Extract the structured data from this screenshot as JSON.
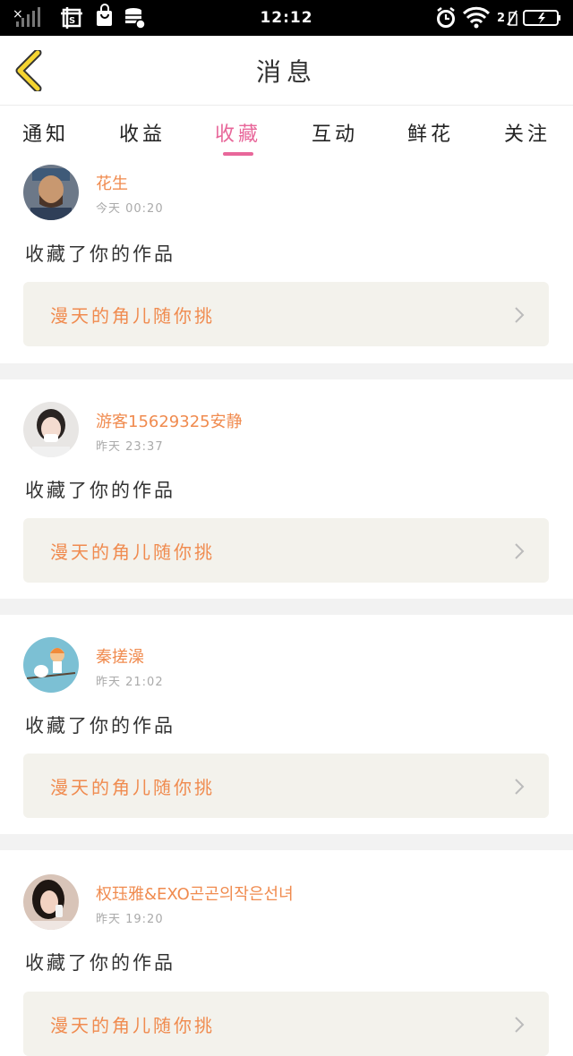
{
  "status_bar": {
    "time": "12:12",
    "battery_label": "2"
  },
  "header": {
    "title": "消息"
  },
  "tabs": [
    {
      "label": "通知",
      "active": false
    },
    {
      "label": "收益",
      "active": false
    },
    {
      "label": "收藏",
      "active": true
    },
    {
      "label": "互动",
      "active": false
    },
    {
      "label": "鲜花",
      "active": false
    },
    {
      "label": "关注",
      "active": false
    }
  ],
  "messages": [
    {
      "user": "花生",
      "time": "今天 00:20",
      "action": "收藏了你的作品",
      "work_title": "漫天的角儿随你挑"
    },
    {
      "user": "游客15629325安静",
      "time": "昨天 23:37",
      "action": "收藏了你的作品",
      "work_title": "漫天的角儿随你挑"
    },
    {
      "user": "秦搓澡",
      "time": "昨天 21:02",
      "action": "收藏了你的作品",
      "work_title": "漫天的角儿随你挑"
    },
    {
      "user": "权珏雅&EXO곤곤의작은선녀",
      "time": "昨天 19:20",
      "action": "收藏了你的作品",
      "work_title": "漫天的角儿随你挑"
    }
  ],
  "colors": {
    "accent_pink": "#e8679a",
    "username_orange": "#f08b4f",
    "work_card_bg": "#f3f2ec",
    "back_chevron": "#f5d531"
  }
}
